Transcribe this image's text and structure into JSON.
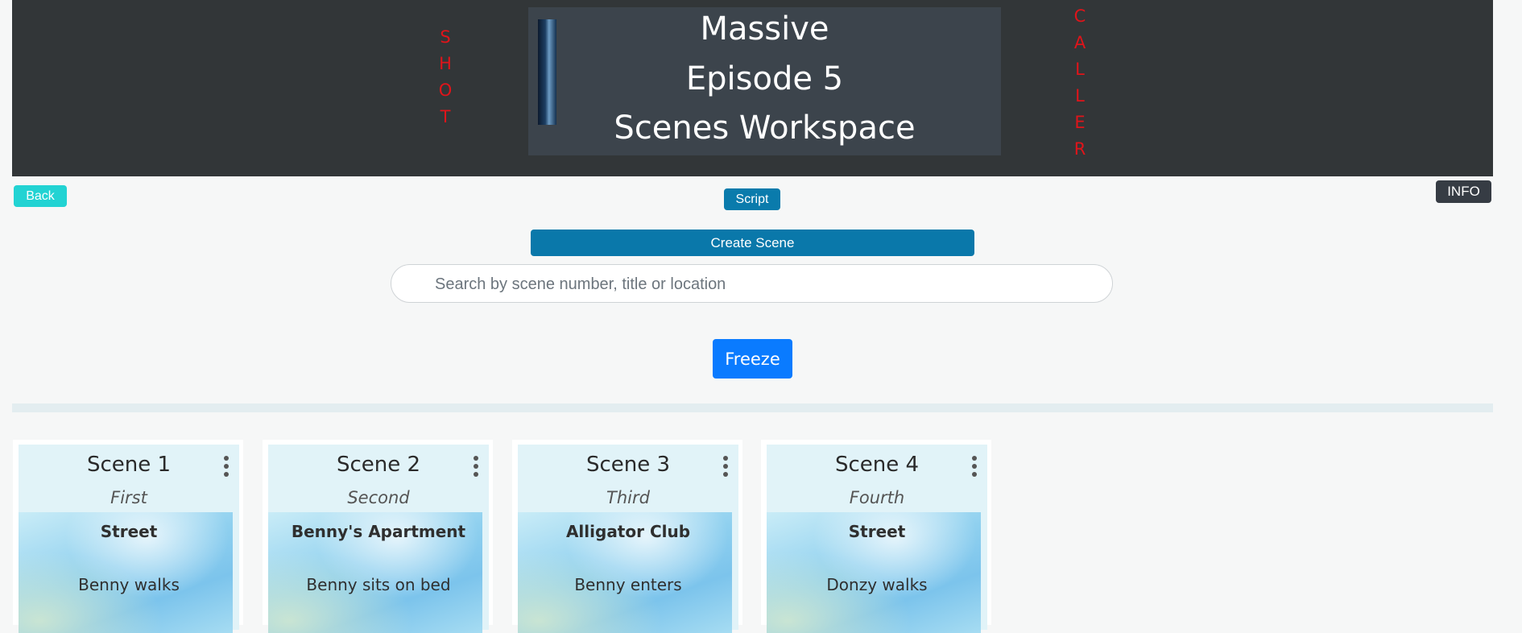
{
  "header": {
    "side_left": [
      "S",
      "H",
      "O",
      "T"
    ],
    "side_right": [
      "C",
      "A",
      "L",
      "L",
      "E",
      "R"
    ],
    "title_line1": "Massive",
    "title_line2": "Episode 5",
    "title_line3": "Scenes Workspace"
  },
  "toolbar": {
    "back_label": "Back",
    "script_label": "Script",
    "info_label": "INFO",
    "create_scene_label": "Create Scene",
    "freeze_label": "Freeze"
  },
  "search": {
    "placeholder": "Search by scene number, title or location",
    "value": ""
  },
  "scenes": [
    {
      "title": "Scene 1",
      "subtitle": "First",
      "location": "Street",
      "description": "Benny walks"
    },
    {
      "title": "Scene 2",
      "subtitle": "Second",
      "location": "Benny's Apartment",
      "description": "Benny sits on bed"
    },
    {
      "title": "Scene 3",
      "subtitle": "Third",
      "location": "Alligator Club",
      "description": "Benny enters"
    },
    {
      "title": "Scene 4",
      "subtitle": "Fourth",
      "location": "Street",
      "description": "Donzy walks"
    }
  ],
  "colors": {
    "header_bg": "#323638",
    "side_text": "#e0141a",
    "accent_primary": "#0a78aa",
    "freeze": "#0a7bff",
    "back": "#22d3d3"
  }
}
